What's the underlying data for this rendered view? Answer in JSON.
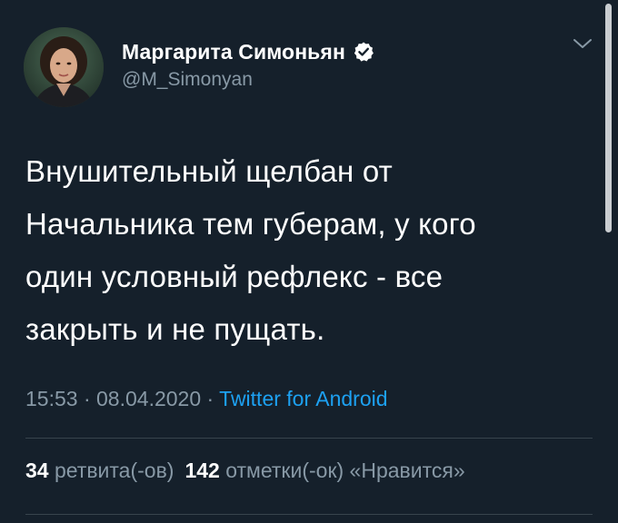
{
  "author": {
    "display_name": "Маргарита Симоньян",
    "handle": "@M_Simonyan",
    "verified": true,
    "avatar_icon": "profile-photo"
  },
  "tweet": {
    "lines": [
      "Внушительный щелбан от",
      "Начальника тем губерам, у кого",
      "один условный рефлекс - все",
      "закрыть и не пущать."
    ],
    "time": "15:53",
    "separator": "·",
    "date": "08.04.2020",
    "source": "Twitter for Android"
  },
  "stats": {
    "retweets_count": "34",
    "retweets_label": "ретвита(-ов)",
    "likes_count": "142",
    "likes_label": "отметки(-ок) «Нравится»"
  },
  "colors": {
    "background": "#15202b",
    "text": "#ffffff",
    "secondary": "#8899a6",
    "link": "#1da1f2",
    "divider": "#38444d"
  },
  "icons": {
    "verified": "verified-badge-icon",
    "menu": "chevron-down-icon"
  }
}
